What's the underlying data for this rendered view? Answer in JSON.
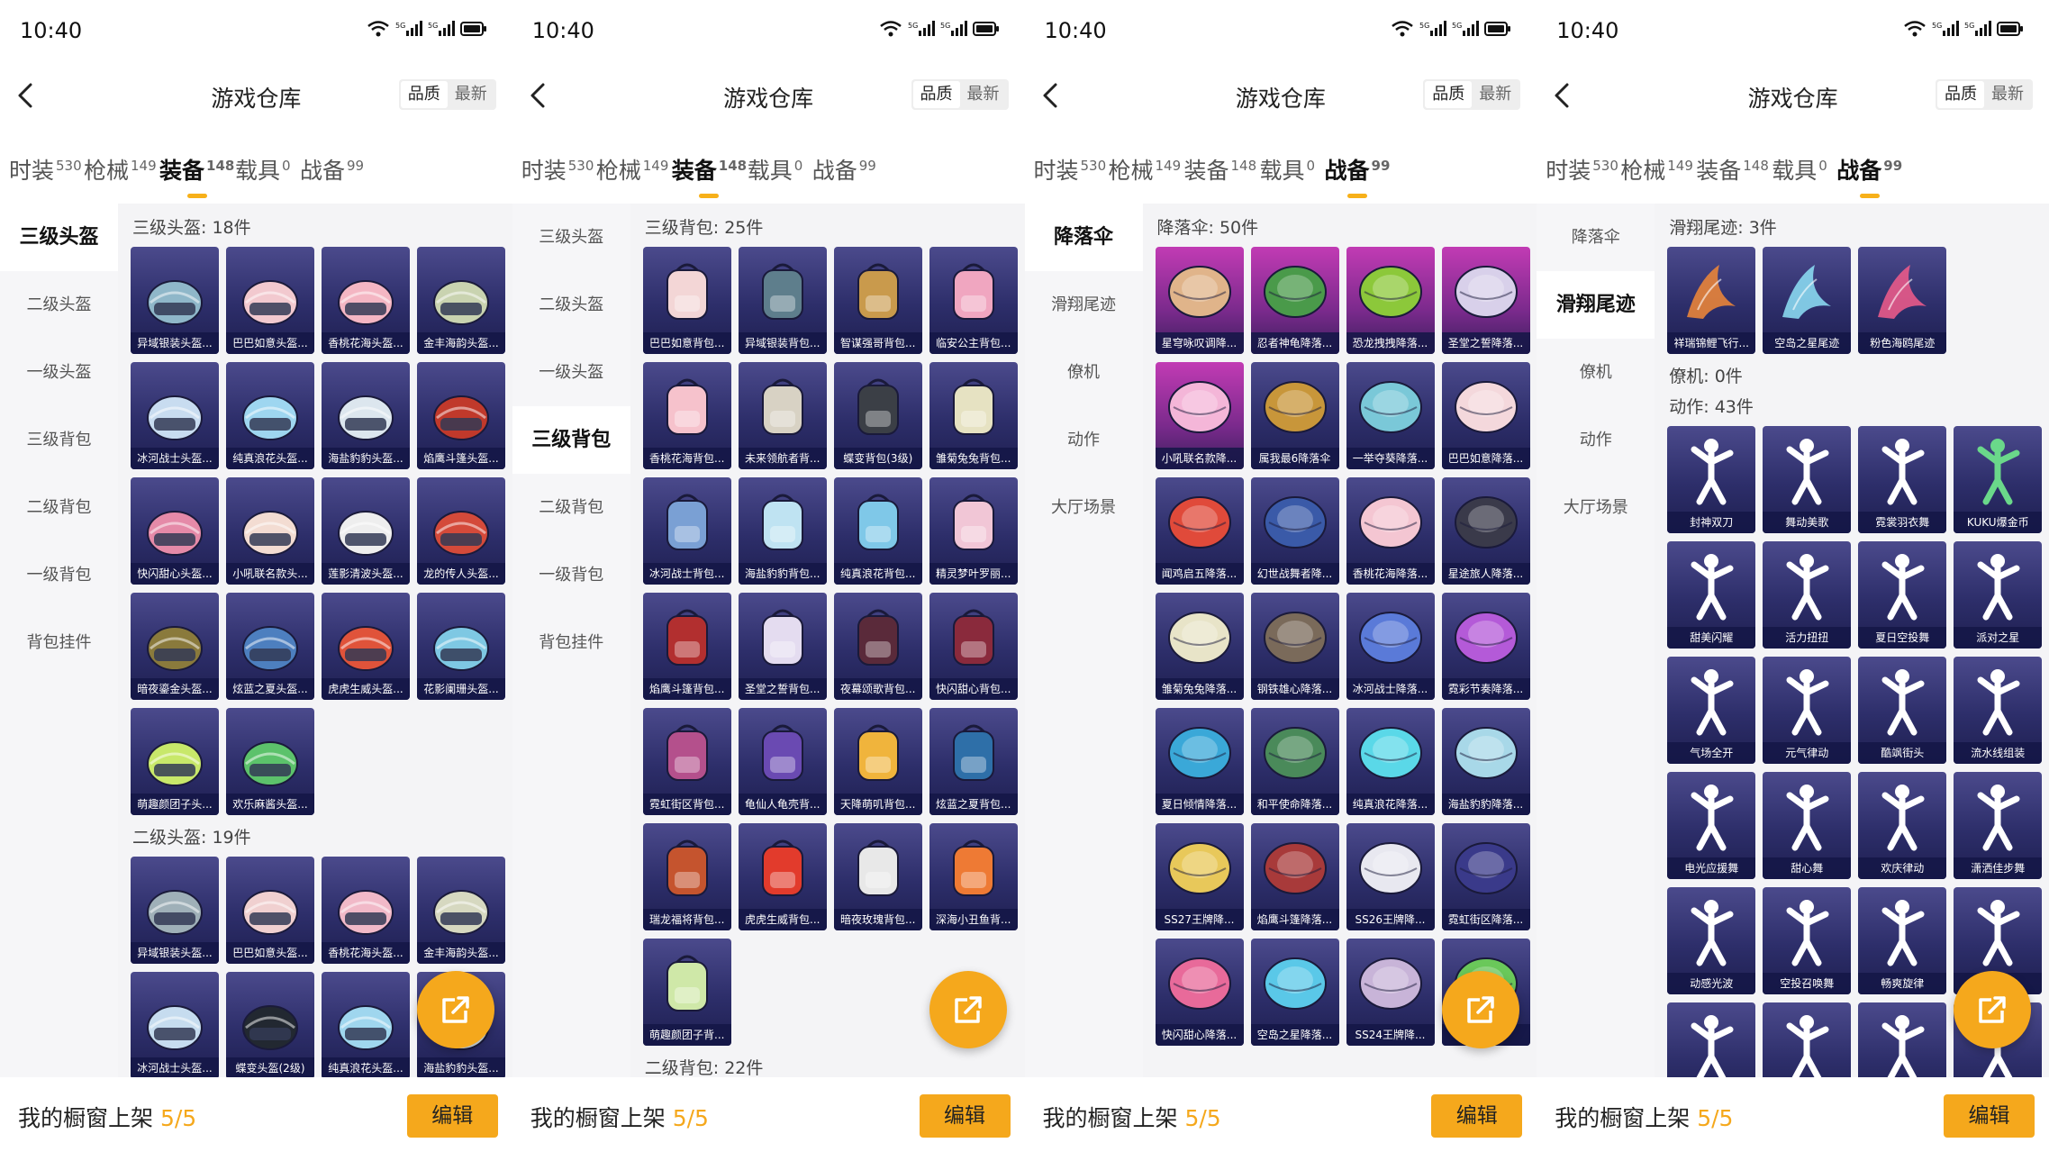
{
  "screens": [
    {
      "status": {
        "time": "10:40"
      },
      "header": {
        "title": "游戏仓库",
        "sort_options": [
          "品质",
          "最新"
        ],
        "active_sort": 0
      },
      "categories": [
        {
          "label": "时装",
          "count": "530"
        },
        {
          "label": "枪械",
          "count": "149"
        },
        {
          "label": "装备",
          "count": "148"
        },
        {
          "label": "载具",
          "count": "0"
        },
        {
          "label": "战备",
          "count": "99"
        }
      ],
      "active_category": 2,
      "sidebar": [
        "三级头盔",
        "二级头盔",
        "一级头盔",
        "三级背包",
        "二级背包",
        "一级背包",
        "背包挂件"
      ],
      "active_sidebar": 0,
      "sections": [
        {
          "title": "三级头盔: 18件",
          "items": [
            {
              "name": "异域银装头盔...",
              "icon": "helmet-icon",
              "color": "#8fb7c9"
            },
            {
              "name": "巴巴如意头盔...",
              "icon": "helmet-icon",
              "color": "#f2c9cf"
            },
            {
              "name": "香桃花海头盔...",
              "icon": "helmet-icon",
              "color": "#f4b6c3"
            },
            {
              "name": "金丰海韵头盔...",
              "icon": "helmet-icon",
              "color": "#c9d3b0"
            },
            {
              "name": "冰河战士头盔...",
              "icon": "helmet-icon",
              "color": "#c8dcf0"
            },
            {
              "name": "纯真浪花头盔...",
              "icon": "helmet-icon",
              "color": "#9ed6f0"
            },
            {
              "name": "海盐豹豹头盔...",
              "icon": "helmet-icon",
              "color": "#dce6ee"
            },
            {
              "name": "焰鹰斗篷头盔...",
              "icon": "helmet-icon",
              "color": "#c0392b"
            },
            {
              "name": "快闪甜心头盔...",
              "icon": "helmet-icon",
              "color": "#e58aa8"
            },
            {
              "name": "小吼联名款头...",
              "icon": "helmet-icon",
              "color": "#f3dcd2"
            },
            {
              "name": "莲影清波头盔...",
              "icon": "helmet-icon",
              "color": "#eeeeee"
            },
            {
              "name": "龙的传人头盔...",
              "icon": "helmet-icon",
              "color": "#d44a3a"
            },
            {
              "name": "暗夜鎏金头盔...",
              "icon": "helmet-icon",
              "color": "#8a7a3c"
            },
            {
              "name": "炫蓝之夏头盔...",
              "icon": "helmet-icon",
              "color": "#4d7fbf"
            },
            {
              "name": "虎虎生威头盔...",
              "icon": "helmet-icon",
              "color": "#e0533a"
            },
            {
              "name": "花影阑珊头盔...",
              "icon": "helmet-icon",
              "color": "#7ec8e3"
            },
            {
              "name": "萌趣颜团子头...",
              "icon": "helmet-icon",
              "color": "#c8e86a"
            },
            {
              "name": "欢乐麻酱头盔...",
              "icon": "helmet-icon",
              "color": "#5cc26b"
            }
          ]
        },
        {
          "title": "二级头盔: 19件",
          "items": [
            {
              "name": "异域银装头盔...",
              "icon": "helmet-icon",
              "color": "#9fb0b8"
            },
            {
              "name": "巴巴如意头盔...",
              "icon": "helmet-icon",
              "color": "#f0d0d0"
            },
            {
              "name": "香桃花海头盔...",
              "icon": "helmet-icon",
              "color": "#f1b9c8"
            },
            {
              "name": "金丰海韵头盔...",
              "icon": "helmet-icon",
              "color": "#d6d8c0"
            },
            {
              "name": "冰河战士头盔...",
              "icon": "helmet-icon",
              "color": "#c6dcef"
            },
            {
              "name": "蝶变头盔(2级)",
              "icon": "helmet-icon",
              "color": "#222831"
            },
            {
              "name": "纯真浪花头盔...",
              "icon": "helmet-icon",
              "color": "#9fd6ee"
            },
            {
              "name": "海盐豹豹头盔...",
              "icon": "helmet-icon",
              "color": "#d8e4ec"
            }
          ]
        }
      ],
      "footer": {
        "label": "我的橱窗上架 ",
        "count": "5/5",
        "button": "编辑"
      }
    },
    {
      "status": {
        "time": "10:40"
      },
      "header": {
        "title": "游戏仓库",
        "sort_options": [
          "品质",
          "最新"
        ],
        "active_sort": 0
      },
      "categories": [
        {
          "label": "时装",
          "count": "530"
        },
        {
          "label": "枪械",
          "count": "149"
        },
        {
          "label": "装备",
          "count": "148"
        },
        {
          "label": "载具",
          "count": "0"
        },
        {
          "label": "战备",
          "count": "99"
        }
      ],
      "active_category": 2,
      "sidebar": [
        "三级头盔",
        "二级头盔",
        "一级头盔",
        "三级背包",
        "二级背包",
        "一级背包",
        "背包挂件"
      ],
      "active_sidebar": 3,
      "sections": [
        {
          "title": "三级背包: 25件",
          "items": [
            {
              "name": "巴巴如意背包...",
              "icon": "backpack-icon",
              "color": "#f3d6d6"
            },
            {
              "name": "异域银装背包...",
              "icon": "backpack-icon",
              "color": "#5e7e8c"
            },
            {
              "name": "智谋强哥背包...",
              "icon": "backpack-icon",
              "color": "#c99a4c"
            },
            {
              "name": "临安公主背包...",
              "icon": "backpack-icon",
              "color": "#f0a6c0"
            },
            {
              "name": "香桃花海背包...",
              "icon": "backpack-icon",
              "color": "#f6c2cc"
            },
            {
              "name": "未来领航者背...",
              "icon": "backpack-icon",
              "color": "#d8d2c4"
            },
            {
              "name": "蝶变背包(3级)",
              "icon": "backpack-icon",
              "color": "#3b3f46"
            },
            {
              "name": "雏菊兔兔背包...",
              "icon": "backpack-icon",
              "color": "#e6e2c2"
            },
            {
              "name": "冰河战士背包...",
              "icon": "backpack-icon",
              "color": "#7aa0d4"
            },
            {
              "name": "海盐豹豹背包...",
              "icon": "backpack-icon",
              "color": "#bfe3f2"
            },
            {
              "name": "纯真浪花背包...",
              "icon": "backpack-icon",
              "color": "#7fc8e8"
            },
            {
              "name": "精灵梦叶罗丽...",
              "icon": "backpack-icon",
              "color": "#f1c6d6"
            },
            {
              "name": "焰鹰斗篷背包...",
              "icon": "backpack-icon",
              "color": "#b22f2f"
            },
            {
              "name": "圣堂之誓背包...",
              "icon": "backpack-icon",
              "color": "#e4dcf0"
            },
            {
              "name": "夜幕颂歌背包...",
              "icon": "backpack-icon",
              "color": "#5a2a3a"
            },
            {
              "name": "快闪甜心背包...",
              "icon": "backpack-icon",
              "color": "#8a2a3c"
            },
            {
              "name": "霓虹街区背包...",
              "icon": "backpack-icon",
              "color": "#b4508c"
            },
            {
              "name": "龟仙人龟壳背...",
              "icon": "backpack-icon",
              "color": "#6a4ab2"
            },
            {
              "name": "天降萌叽背包...",
              "icon": "backpack-icon",
              "color": "#f0b43c"
            },
            {
              "name": "炫蓝之夏背包...",
              "icon": "backpack-icon",
              "color": "#2e6fa8"
            },
            {
              "name": "瑞龙福将背包...",
              "icon": "backpack-icon",
              "color": "#c5542e"
            },
            {
              "name": "虎虎生威背包...",
              "icon": "backpack-icon",
              "color": "#e23b2c"
            },
            {
              "name": "暗夜玫瑰背包...",
              "icon": "backpack-icon",
              "color": "#e8e8e8"
            },
            {
              "name": "深海小丑鱼背...",
              "icon": "backpack-icon",
              "color": "#ee7a34"
            },
            {
              "name": "萌趣颜团子背...",
              "icon": "backpack-icon",
              "color": "#cfe8a8"
            }
          ]
        },
        {
          "title": "二级背包: 22件",
          "items": []
        }
      ],
      "footer": {
        "label": "我的橱窗上架 ",
        "count": "5/5",
        "button": "编辑"
      }
    },
    {
      "status": {
        "time": "10:40"
      },
      "header": {
        "title": "游戏仓库",
        "sort_options": [
          "品质",
          "最新"
        ],
        "active_sort": 0
      },
      "categories": [
        {
          "label": "时装",
          "count": "530"
        },
        {
          "label": "枪械",
          "count": "149"
        },
        {
          "label": "装备",
          "count": "148"
        },
        {
          "label": "载具",
          "count": "0"
        },
        {
          "label": "战备",
          "count": "99"
        }
      ],
      "active_category": 4,
      "sidebar": [
        "降落伞",
        "滑翔尾迹",
        "僚机",
        "动作",
        "大厅场景"
      ],
      "active_sidebar": 0,
      "sections": [
        {
          "title": "降落伞: 50件",
          "items": [
            {
              "name": "星穹咏叹调降...",
              "icon": "parachute-icon",
              "color": "#e0b48a",
              "pink": true
            },
            {
              "name": "忍者神龟降落...",
              "icon": "parachute-icon",
              "color": "#4a9a4a",
              "pink": true
            },
            {
              "name": "恐龙拽拽降落...",
              "icon": "parachute-icon",
              "color": "#8cc83a",
              "pink": true
            },
            {
              "name": "圣堂之誓降落...",
              "icon": "parachute-icon",
              "color": "#d8d0ea",
              "pink": true
            },
            {
              "name": "小吼联名款降...",
              "icon": "parachute-icon",
              "color": "#f4b6d8",
              "pink": true
            },
            {
              "name": "属我最6降落伞",
              "icon": "parachute-icon",
              "color": "#c8963a"
            },
            {
              "name": "一举夺葵降落...",
              "icon": "parachute-icon",
              "color": "#7ac8d8"
            },
            {
              "name": "巴巴如意降落...",
              "icon": "parachute-icon",
              "color": "#f4d8dc"
            },
            {
              "name": "闻鸡启五降落...",
              "icon": "parachute-icon",
              "color": "#e04a3a"
            },
            {
              "name": "幻世战舞者降...",
              "icon": "parachute-icon",
              "color": "#3a5aa8"
            },
            {
              "name": "香桃花海降落...",
              "icon": "parachute-icon",
              "color": "#f4c6d2"
            },
            {
              "name": "星途旅人降落...",
              "icon": "parachute-icon",
              "color": "#3a3a4a"
            },
            {
              "name": "雏菊兔兔降落...",
              "icon": "parachute-icon",
              "color": "#e8e4c8"
            },
            {
              "name": "钢铁雄心降落...",
              "icon": "parachute-icon",
              "color": "#7a6a5a"
            },
            {
              "name": "冰河战士降落...",
              "icon": "parachute-icon",
              "color": "#5a7ad8"
            },
            {
              "name": "霓彩节奏降落...",
              "icon": "parachute-icon",
              "color": "#b45ad8"
            },
            {
              "name": "夏日倾情降落...",
              "icon": "parachute-icon",
              "color": "#3aa8d8"
            },
            {
              "name": "和平使命降落...",
              "icon": "parachute-icon",
              "color": "#4a8a5a"
            },
            {
              "name": "纯真浪花降落...",
              "icon": "parachute-icon",
              "color": "#5ad8e8"
            },
            {
              "name": "海盐豹豹降落...",
              "icon": "parachute-icon",
              "color": "#a8d8e8"
            },
            {
              "name": "SS27王牌降...",
              "icon": "parachute-icon",
              "color": "#e8c85a"
            },
            {
              "name": "焰鹰斗篷降落...",
              "icon": "parachute-icon",
              "color": "#a83a3a"
            },
            {
              "name": "SS26王牌降...",
              "icon": "parachute-icon",
              "color": "#e8e8f0"
            },
            {
              "name": "霓虹街区降落...",
              "icon": "parachute-icon",
              "color": "#3a3a8a"
            },
            {
              "name": "快闪甜心降落...",
              "icon": "parachute-icon",
              "color": "#e86a9a"
            },
            {
              "name": "空岛之星降落...",
              "icon": "parachute-icon",
              "color": "#5ac8e8"
            },
            {
              "name": "SS24王牌降...",
              "icon": "parachute-icon",
              "color": "#c8b4d8"
            },
            {
              "name": "",
              "icon": "parachute-icon",
              "color": "#6ac85a"
            }
          ]
        }
      ],
      "footer": {
        "label": "我的橱窗上架 ",
        "count": "5/5",
        "button": "编辑"
      }
    },
    {
      "status": {
        "time": "10:40"
      },
      "header": {
        "title": "游戏仓库",
        "sort_options": [
          "品质",
          "最新"
        ],
        "active_sort": 0
      },
      "categories": [
        {
          "label": "时装",
          "count": "530"
        },
        {
          "label": "枪械",
          "count": "149"
        },
        {
          "label": "装备",
          "count": "148"
        },
        {
          "label": "载具",
          "count": "0"
        },
        {
          "label": "战备",
          "count": "99"
        }
      ],
      "active_category": 4,
      "sidebar": [
        "降落伞",
        "滑翔尾迹",
        "僚机",
        "动作",
        "大厅场景"
      ],
      "active_sidebar": 1,
      "sections": [
        {
          "title": "滑翔尾迹: 3件",
          "items": [
            {
              "name": "祥瑞锦鲤飞行...",
              "icon": "trail-icon",
              "color": "#e8843a"
            },
            {
              "name": "空岛之星尾迹",
              "icon": "trail-icon",
              "color": "#8ad8f0"
            },
            {
              "name": "粉色海鸥尾迹",
              "icon": "trail-icon",
              "color": "#e85a8a"
            }
          ]
        },
        {
          "title": "僚机: 0件",
          "items": []
        },
        {
          "title": "动作: 43件",
          "items": [
            {
              "name": "封神双刀",
              "icon": "emote-icon",
              "color": "#ffffff"
            },
            {
              "name": "舞动美歌",
              "icon": "emote-icon",
              "color": "#ffffff"
            },
            {
              "name": "霓裳羽衣舞",
              "icon": "emote-icon",
              "color": "#ffffff"
            },
            {
              "name": "KUKU爆金币",
              "icon": "emote-icon",
              "color": "#6ad88a"
            },
            {
              "name": "甜美闪耀",
              "icon": "emote-icon",
              "color": "#ffffff"
            },
            {
              "name": "活力扭扭",
              "icon": "emote-icon",
              "color": "#ffffff"
            },
            {
              "name": "夏日空投舞",
              "icon": "emote-icon",
              "color": "#ffffff"
            },
            {
              "name": "派对之星",
              "icon": "emote-icon",
              "color": "#ffffff"
            },
            {
              "name": "气场全开",
              "icon": "emote-icon",
              "color": "#ffffff"
            },
            {
              "name": "元气律动",
              "icon": "emote-icon",
              "color": "#ffffff"
            },
            {
              "name": "酷飒街头",
              "icon": "emote-icon",
              "color": "#ffffff"
            },
            {
              "name": "流水线组装",
              "icon": "emote-icon",
              "color": "#ffffff"
            },
            {
              "name": "电光应援舞",
              "icon": "emote-icon",
              "color": "#ffffff"
            },
            {
              "name": "甜心舞",
              "icon": "emote-icon",
              "color": "#ffffff"
            },
            {
              "name": "欢庆律动",
              "icon": "emote-icon",
              "color": "#ffffff"
            },
            {
              "name": "潇洒佳步舞",
              "icon": "emote-icon",
              "color": "#ffffff"
            },
            {
              "name": "动感光波",
              "icon": "emote-icon",
              "color": "#ffffff"
            },
            {
              "name": "空投召唤舞",
              "icon": "emote-icon",
              "color": "#ffffff"
            },
            {
              "name": "畅爽旋律",
              "icon": "emote-icon",
              "color": "#ffffff"
            },
            {
              "name": "",
              "icon": "emote-icon",
              "color": "#ffffff"
            },
            {
              "name": "",
              "icon": "emote-icon",
              "color": "#ffffff"
            },
            {
              "name": "",
              "icon": "emote-icon",
              "color": "#ffffff"
            },
            {
              "name": "",
              "icon": "emote-icon",
              "color": "#ffffff"
            },
            {
              "name": "",
              "icon": "emote-icon",
              "color": "#ffffff"
            }
          ]
        }
      ],
      "footer": {
        "label": "我的橱窗上架 ",
        "count": "5/5",
        "button": "编辑"
      }
    }
  ],
  "colors": {
    "accent": "#f5a81c",
    "tile_bg": "#2d2e6a",
    "tile_pink": "#7a2a8c"
  }
}
